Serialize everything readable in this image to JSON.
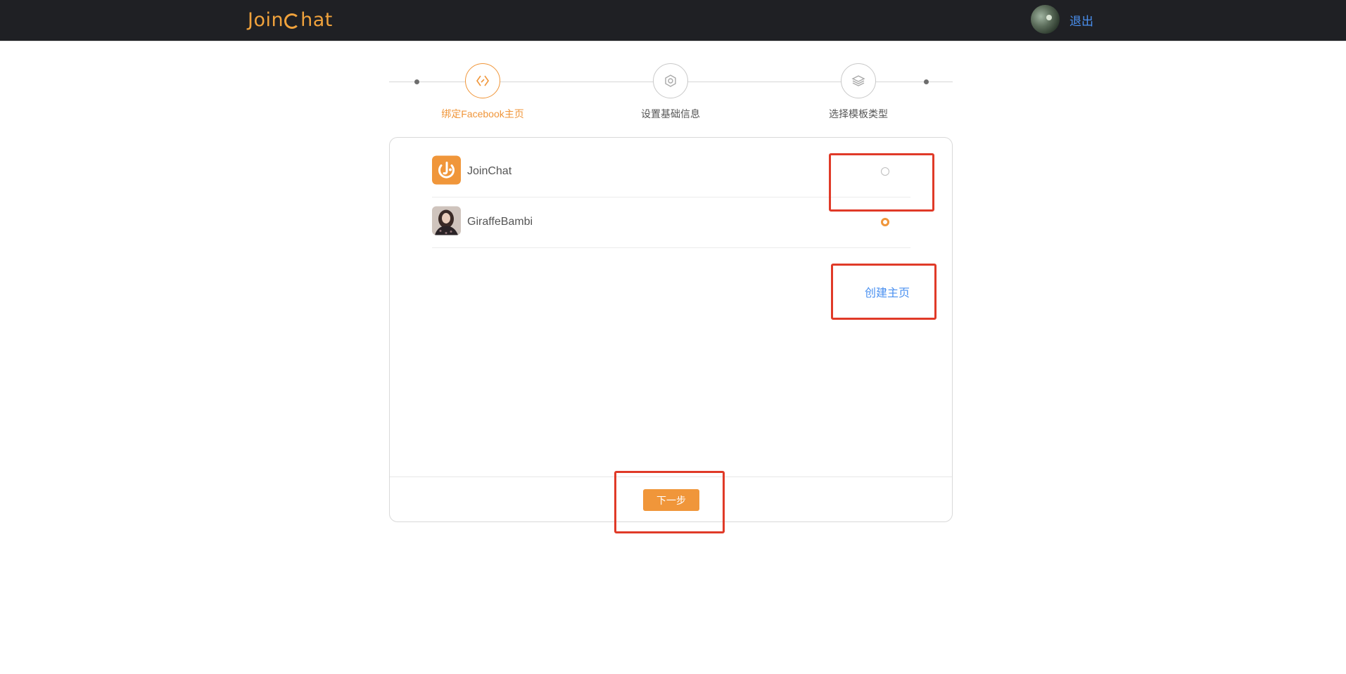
{
  "header": {
    "logo_text_pre": "Join",
    "logo_text_post": "hat",
    "logout_label": "退出"
  },
  "steps": [
    {
      "label": "绑定Facebook主页",
      "icon": "link-icon",
      "active": true
    },
    {
      "label": "设置基础信息",
      "icon": "gear-icon",
      "active": false
    },
    {
      "label": "选择模板类型",
      "icon": "layers-icon",
      "active": false
    }
  ],
  "pages": [
    {
      "name": "JoinChat",
      "icon": "joinchat-logo-icon",
      "selected": false
    },
    {
      "name": "GiraffeBambi",
      "icon": "profile-photo",
      "selected": true
    }
  ],
  "create_page_label": "创建主页",
  "next_label": "下一步",
  "colors": {
    "accent": "#f0963a",
    "link": "#4a90f0",
    "topbar": "#1f2024",
    "highlight": "#e03a28"
  }
}
